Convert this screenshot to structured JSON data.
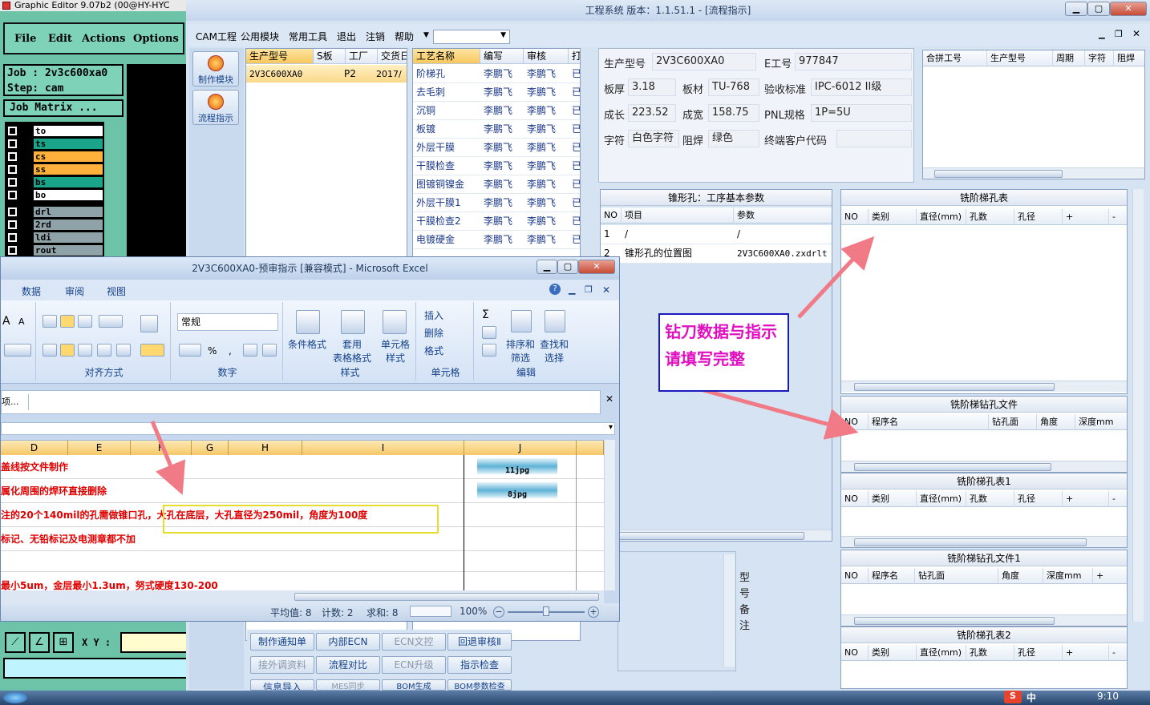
{
  "graphic_editor": {
    "title": "Graphic Editor 9.07b2 (00@HY-HYC",
    "menu": [
      "File",
      "Edit",
      "Actions",
      "Options"
    ],
    "job": "Job : 2v3c600xa0",
    "step": "Step: cam",
    "job_matrix": "Job Matrix ...",
    "layers": [
      {
        "name": "to",
        "color": "#ffffff"
      },
      {
        "name": "ts",
        "color": "#1aa58a"
      },
      {
        "name": "cs",
        "color": "#ffb13b"
      },
      {
        "name": "ss",
        "color": "#ffb13b"
      },
      {
        "name": "bs",
        "color": "#1aa58a"
      },
      {
        "name": "bo",
        "color": "#ffffff"
      },
      {
        "name": "drl",
        "color": "#8fa2a8"
      },
      {
        "name": "2rd",
        "color": "#8fa2a8"
      },
      {
        "name": "ldi",
        "color": "#8fa2a8"
      },
      {
        "name": "rout",
        "color": "#8fa2a8"
      }
    ],
    "xy_label": "X Y :"
  },
  "eng": {
    "title": "工程系统   版本：1.1.51.1 - [流程指示]",
    "menu": [
      "CAM工程",
      "公用模块",
      "常用工具",
      "退出",
      "注销",
      "帮助"
    ],
    "left_buttons": [
      "制作模块",
      "流程指示"
    ],
    "product_grid": {
      "headers": [
        "生产型号",
        "S板",
        "工厂",
        "交货日"
      ],
      "row": [
        "2V3C600XA0",
        "P2",
        "2017/"
      ]
    },
    "process_grid": {
      "headers": [
        "工艺名称",
        "编写",
        "审核",
        "打"
      ],
      "rows": [
        [
          "阶梯孔",
          "李鹏飞",
          "李鹏飞",
          "已"
        ],
        [
          "去毛刺",
          "李鹏飞",
          "李鹏飞",
          "已"
        ],
        [
          "沉铜",
          "李鹏飞",
          "李鹏飞",
          "已"
        ],
        [
          "板镀",
          "李鹏飞",
          "李鹏飞",
          "已"
        ],
        [
          "外层干膜",
          "李鹏飞",
          "李鹏飞",
          "已"
        ],
        [
          "干膜检查",
          "李鹏飞",
          "李鹏飞",
          "已"
        ],
        [
          "图镀铜镍金",
          "李鹏飞",
          "李鹏飞",
          "已"
        ],
        [
          "外层干膜1",
          "李鹏飞",
          "李鹏飞",
          "已"
        ],
        [
          "干膜检查2",
          "李鹏飞",
          "李鹏飞",
          "已"
        ],
        [
          "电镀硬金",
          "李鹏飞",
          "李鹏飞",
          "已"
        ]
      ]
    },
    "info": {
      "model_label": "生产型号",
      "model": "2V3C600XA0",
      "e_label": "E工号",
      "e": "977847",
      "thick_label": "板厚",
      "thick": "3.18",
      "mat_label": "板材",
      "mat": "TU-768",
      "std_label": "验收标准",
      "std": "IPC-6012 II级",
      "len_label": "成长",
      "len": "223.52",
      "wid_label": "成宽",
      "wid": "158.75",
      "pnl_label": "PNL规格",
      "pnl": "1P=5U",
      "char_label": "字符",
      "char": "白色字符",
      "mask_label": "阻焊",
      "mask": "绿色",
      "cust_label": "终端客户代码",
      "cust": ""
    },
    "combine_headers": [
      "合拼工号",
      "生产型号",
      "周期",
      "字符",
      "阻焊"
    ],
    "cone": {
      "title": "锥形孔：工序基本参数",
      "headers": [
        "NO",
        "项目",
        "参数"
      ],
      "rows": [
        [
          "1",
          "/",
          "/"
        ],
        [
          "2",
          "锥形孔的位置图",
          "2V3C600XA0.zxdrlt"
        ]
      ]
    },
    "mill1": {
      "title": "铣阶梯孔表",
      "headers": [
        "NO",
        "类别",
        "直径(mm)",
        "孔数",
        "孔径",
        "+",
        "-"
      ]
    },
    "mill1_file": {
      "title": "铣阶梯钻孔文件",
      "headers": [
        "NO",
        "程序名",
        "钻孔面",
        "角度",
        "深度mm"
      ]
    },
    "mill2": {
      "title": "铣阶梯孔表1",
      "headers": [
        "NO",
        "类别",
        "直径(mm)",
        "孔数",
        "孔径",
        "+",
        "-"
      ]
    },
    "mill2_file": {
      "title": "铣阶梯钻孔文件1",
      "headers": [
        "NO",
        "程序名",
        "钻孔面",
        "角度",
        "深度mm",
        "+"
      ]
    },
    "mill3": {
      "title": "铣阶梯孔表2",
      "headers": [
        "NO",
        "类别",
        "直径(mm)",
        "孔数",
        "孔径",
        "+",
        "-"
      ]
    },
    "remark_label": "型号备注",
    "bottom_buttons": [
      {
        "label": "制作通知单",
        "enabled": true
      },
      {
        "label": "内部ECN",
        "enabled": true
      },
      {
        "label": "ECN文控",
        "enabled": false
      },
      {
        "label": "回退审核Ⅱ",
        "enabled": true
      },
      {
        "label": "接外调资料",
        "enabled": false
      },
      {
        "label": "流程对比",
        "enabled": true
      },
      {
        "label": "ECN升级",
        "enabled": false
      },
      {
        "label": "指示检查",
        "enabled": true
      },
      {
        "label": "信息导入",
        "enabled": true
      },
      {
        "label": "MES同步",
        "enabled": false
      },
      {
        "label": "BOM生成",
        "enabled": true
      },
      {
        "label": "BOM参数检查",
        "enabled": true
      }
    ]
  },
  "excel": {
    "title": "2V3C600XA0-预审指示  [兼容模式] - Microsoft Excel",
    "tabs": [
      "数据",
      "审阅",
      "视图"
    ],
    "ribbon": {
      "font_size_up": "A",
      "font_size_down": "A",
      "number_format": "常规",
      "groups": [
        "对齐方式",
        "数字",
        "样式",
        "单元格",
        "编辑"
      ],
      "cond_format": "条件格式",
      "table_format": "套用\n表格格式",
      "cell_style": "单元格\n样式",
      "insert": "插入",
      "delete": "删除",
      "format": "格式",
      "sort": "排序和\n筛选",
      "find": "查找和\n选择",
      "percent": "%",
      "comma": ","
    },
    "formula_bar": "项...",
    "columns": [
      "D",
      "E",
      "F",
      "G",
      "H",
      "I",
      "J"
    ],
    "rows": [
      "盖线按文件制作",
      "属化周围的焊环直接删除",
      "注的20个140mil的孔需做锥口孔，大孔在底层，大孔直径为250mil，角度为100度",
      "标记、无铅标记及电测章都不加",
      "",
      "最小5um，金层最小1.3um，努式硬度130-200"
    ],
    "images": [
      "11jpg",
      "8jpg"
    ],
    "status": {
      "avg": "平均值: 8",
      "count": "计数: 2",
      "sum": "求和: 8",
      "zoom": "100%"
    }
  },
  "note": "钻刀数据与指示请填写完整",
  "taskbar": {
    "time": "9:10",
    "ime": "中"
  }
}
